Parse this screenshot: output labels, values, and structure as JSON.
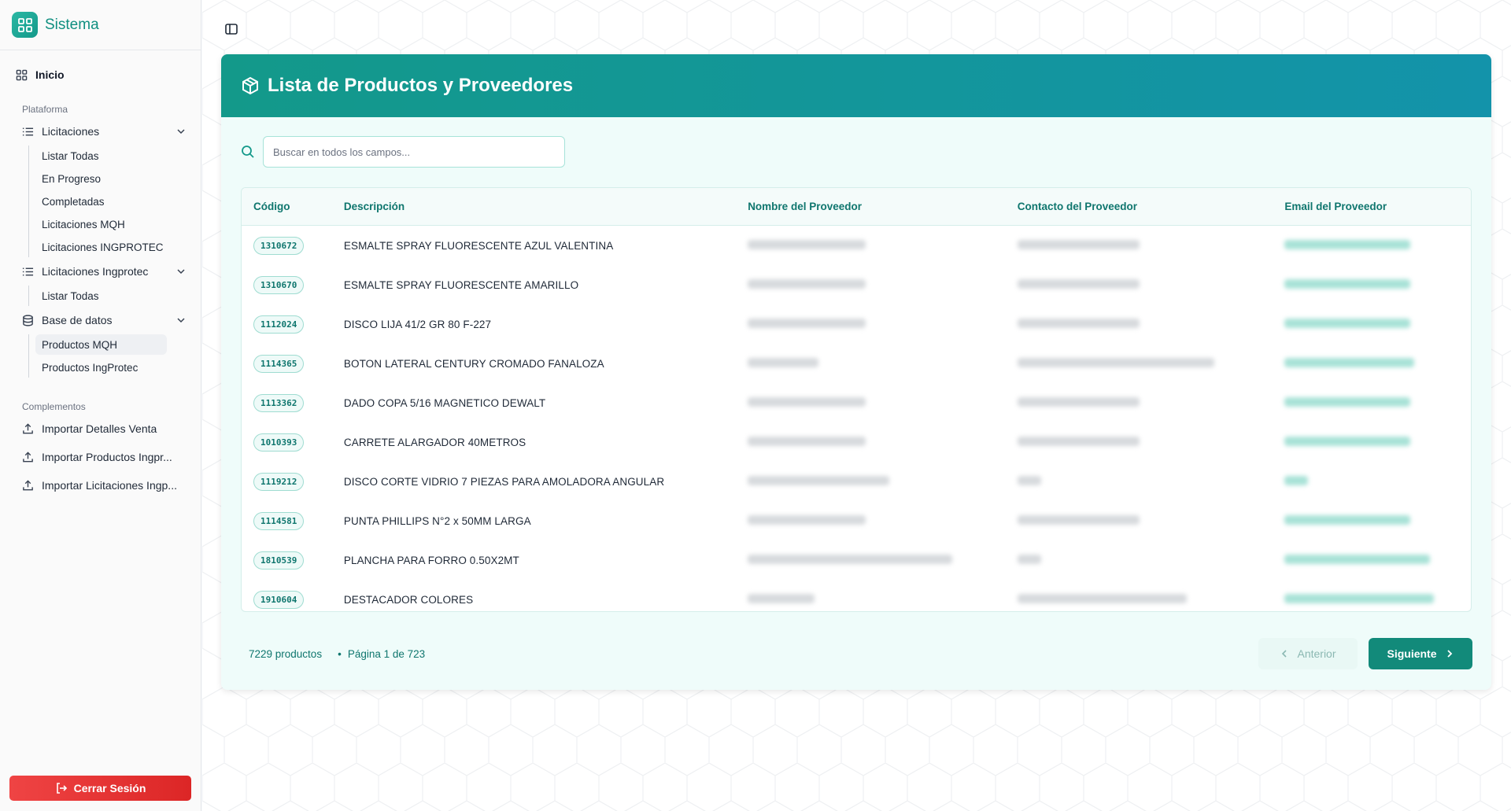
{
  "sidebar": {
    "brand": "Sistema",
    "home": "Inicio",
    "platform_label": "Plataforma",
    "groups": [
      {
        "label": "Licitaciones",
        "items": [
          "Listar Todas",
          "En Progreso",
          "Completadas",
          "Licitaciones MQH",
          "Licitaciones INGPROTEC"
        ]
      },
      {
        "label": "Licitaciones Ingprotec",
        "items": [
          "Listar Todas"
        ]
      },
      {
        "label": "Base de datos",
        "items": [
          "Productos MQH",
          "Productos IngProtec"
        ]
      }
    ],
    "complements_label": "Complementos",
    "complements": [
      "Importar Detalles Venta",
      "Importar Productos Ingpr...",
      "Importar Licitaciones Ingp..."
    ],
    "logout": "Cerrar Sesión"
  },
  "card": {
    "title": "Lista de Productos y Proveedores",
    "search_placeholder": "Buscar en todos los campos...",
    "columns": [
      "Código",
      "Descripción",
      "Nombre del Proveedor",
      "Contacto del Proveedor",
      "Email del Proveedor"
    ],
    "rows": [
      {
        "code": "1310672",
        "desc": "ESMALTE SPRAY FLUORESCENTE AZUL VALENTINA"
      },
      {
        "code": "1310670",
        "desc": "ESMALTE SPRAY FLUORESCENTE AMARILLO"
      },
      {
        "code": "1112024",
        "desc": "DISCO LIJA 41/2 GR 80 F-227"
      },
      {
        "code": "1114365",
        "desc": "BOTON LATERAL CENTURY CROMADO FANALOZA"
      },
      {
        "code": "1113362",
        "desc": "DADO COPA 5/16 MAGNETICO DEWALT"
      },
      {
        "code": "1010393",
        "desc": "CARRETE ALARGADOR 40METROS"
      },
      {
        "code": "1119212",
        "desc": "DISCO CORTE VIDRIO 7 PIEZAS PARA AMOLADORA ANGULAR"
      },
      {
        "code": "1114581",
        "desc": "PUNTA PHILLIPS N°2 x 50MM LARGA"
      },
      {
        "code": "1810539",
        "desc": "PLANCHA PARA FORRO 0.50X2MT"
      },
      {
        "code": "1910604",
        "desc": "DESTACADOR COLORES"
      }
    ],
    "count": "7229 productos",
    "page": "Página 1 de 723",
    "prev": "Anterior",
    "next": "Siguiente"
  },
  "colors": {
    "accent": "#128a7a",
    "header_start": "#13998a",
    "header_end": "#1393aa",
    "logout": "#ef4444"
  }
}
